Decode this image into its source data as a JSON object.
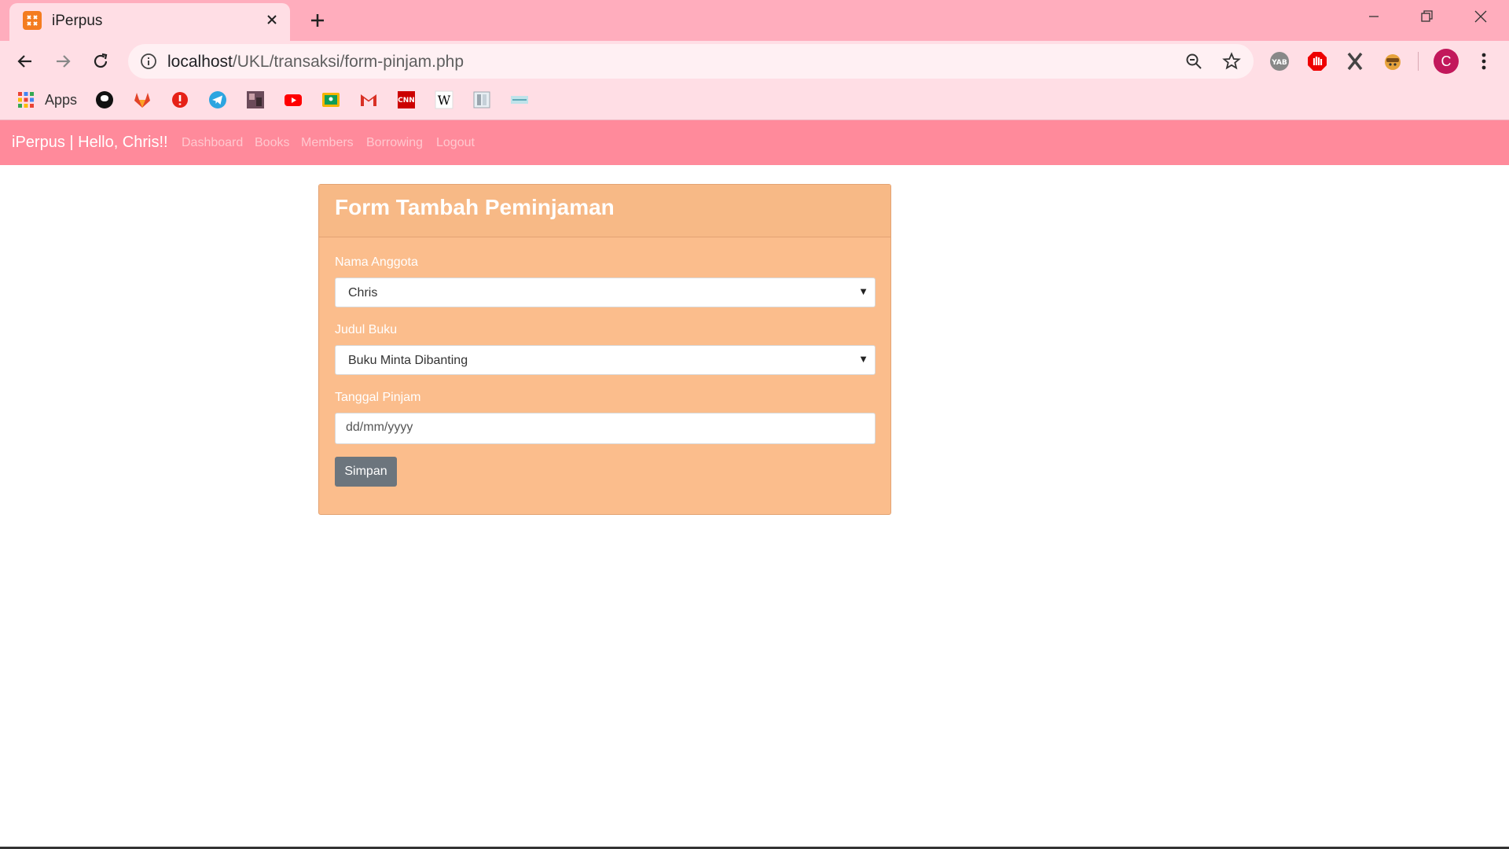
{
  "browser": {
    "tab": {
      "title": "iPerpus"
    },
    "address_bar": {
      "host": "localhost",
      "path": "/UKL/transaksi/form-pinjam.php"
    },
    "profile_initial": "C",
    "extensions": [
      "yab-icon",
      "adblock-icon",
      "x-icon",
      "monkey-icon"
    ],
    "bookmarks": {
      "apps_label": "Apps",
      "items": [
        "github-icon",
        "gitlab-icon",
        "alert-icon",
        "telegram-icon",
        "photo-icon",
        "youtube-icon",
        "classroom-icon",
        "gmail-icon",
        "cnn-icon",
        "wikipedia-icon",
        "reader-icon",
        "bookmark-icon"
      ]
    }
  },
  "navbar": {
    "brand": "iPerpus | Hello, Chris!!",
    "links": [
      "Dashboard",
      "Books",
      "Members",
      "Borrowing",
      "Logout"
    ]
  },
  "form": {
    "title": "Form Tambah Peminjaman",
    "member_label": "Nama Anggota",
    "member_value": "Chris",
    "book_label": "Judul Buku",
    "book_value": "Buku Minta Dibanting",
    "date_label": "Tanggal Pinjam",
    "date_placeholder": "dd/mm/yyyy",
    "submit_label": "Simpan"
  },
  "colors": {
    "tabstrip": "#ffadbd",
    "toolbar": "#ffdee5",
    "navbar": "#ff8a9b",
    "card": "#fbbd8c",
    "button": "#6c757d"
  }
}
